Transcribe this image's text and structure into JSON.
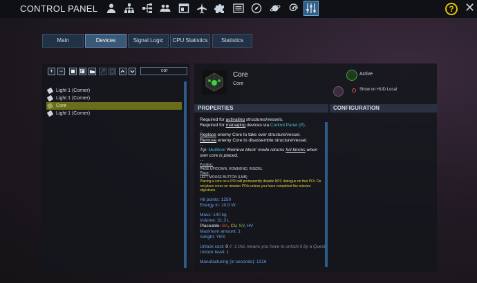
{
  "header": {
    "title": "CONTROL PANEL",
    "tools": [
      "person-icon",
      "network-icon",
      "hierarchy-icon",
      "group-icon",
      "window-icon",
      "airplane-icon",
      "puzzle-icon",
      "list-icon",
      "compass-icon",
      "planet-icon",
      "galaxy-icon",
      "sliders-icon"
    ],
    "active_tool": "sliders-icon",
    "help_label": "?",
    "close_label": "✕"
  },
  "tabs": [
    {
      "label": "Main"
    },
    {
      "label": "Devices"
    },
    {
      "label": "Signal Logic"
    },
    {
      "label": "CPU Statistics"
    },
    {
      "label": "Statistics"
    }
  ],
  "active_tab": "Devices",
  "device_toolbar": {
    "add_label": "+",
    "remove_label": "−",
    "filter_value": "cor"
  },
  "devices": [
    {
      "label": "Light 1 (Corner)"
    },
    {
      "label": "Light 1 (Corner)"
    },
    {
      "label": "Core"
    },
    {
      "label": "Light 1 (Corner)"
    }
  ],
  "selected_device": "Core",
  "detail": {
    "name": "Core",
    "subtitle": "Core",
    "active_label": "Active",
    "hud_label": "Show on HUD Local",
    "properties_header": "PROPERTIES",
    "configuration_header": "CONFIGURATION"
  },
  "properties": {
    "l1_a": "Required for ",
    "l1_b": "activating",
    "l1_c": " structures/vessels.",
    "l2_a": "Required for ",
    "l2_b": "managing",
    "l2_c": " devices via ",
    "l2_d": "Control Panel (P)",
    "l2_e": ".",
    "sep1": "- -",
    "l3_a": "Replace",
    "l3_b": " enemy Core to take over structure/vessel.",
    "l4_a": "Remove",
    "l4_b": " enemy Core to disassemble structure/vessel.",
    "sep2": "- -",
    "tip_a": "Tip: ",
    "tip_b": "Multitool",
    "tip_c": " 'Retrieve block' mode returns ",
    "tip_d": "full blocks",
    "tip_e": " when own core is placed.",
    "sep3": "- -",
    "position_h": "Position:",
    "position_v": "PAGE UP/DOWN, HOME/END, INS/DEL",
    "place_h": "Place:",
    "place_v": "LEFT MOUSE BUTTON (LMB)",
    "warning": "Placing a core on a POI will permanently disable NPC dialogue on that POI. Do not place cores on mission POIs unless you have completed the mission objectives.",
    "hit_points": "Hit points: 1250",
    "energy": "Energy in: 10,0 W",
    "mass": "Mass: 140 kg",
    "volume": "Volume: 31,3 L",
    "placeable_a": "Placeable: ",
    "placeable_ba": "BA",
    "placeable_cv": "CV",
    "placeable_sv": "SV",
    "placeable_hv": "HV",
    "comma": ", ",
    "max_amount": "Maximum amount: 1",
    "airtight": "Airtight: YES",
    "unlock_cost_a": "Unlock cost: ",
    "unlock_cost_b": "0",
    "unlock_cost_note": "// -1 this means you have to unlock it by a Quest",
    "unlock_level": "Unlock level: 1",
    "crafting": "Manufacturing (in seconds): 1316"
  }
}
